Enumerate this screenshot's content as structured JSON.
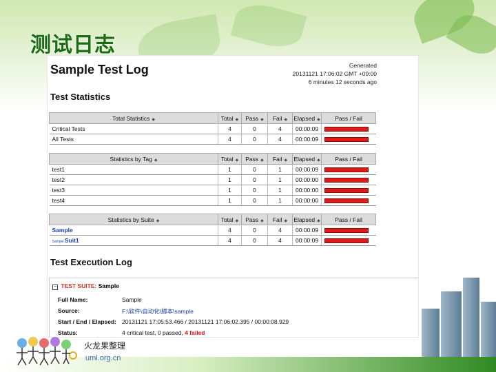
{
  "slide": {
    "title": "测试日志",
    "footer_name": "火龙果整理",
    "footer_site": "uml.org.cn",
    "colors": {
      "title": "#1b6b14",
      "fail_bar": "#dd1a1a",
      "link": "#1a3fae"
    }
  },
  "log": {
    "title": "Sample Test Log",
    "generated_label": "Generated",
    "generated_time": "20131121 17:06:02 GMT +09:00",
    "generated_ago": "6 minutes 12 seconds ago",
    "stats_heading": "Test Statistics",
    "columns": [
      "Total",
      "Pass",
      "Fail",
      "Elapsed",
      "Pass / Fail"
    ],
    "total_stats": {
      "header": "Total Statistics",
      "rows": [
        {
          "name": "Critical Tests",
          "total": "4",
          "pass": "0",
          "fail": "4",
          "elapsed": "00:00:09",
          "fail_fraction": 1
        },
        {
          "name": "All Tests",
          "total": "4",
          "pass": "0",
          "fail": "4",
          "elapsed": "00:00:09",
          "fail_fraction": 1
        }
      ]
    },
    "tag_stats": {
      "header": "Statistics by Tag",
      "rows": [
        {
          "name": "test1",
          "total": "1",
          "pass": "0",
          "fail": "1",
          "elapsed": "00:00:09",
          "fail_fraction": 1
        },
        {
          "name": "test2",
          "total": "1",
          "pass": "0",
          "fail": "1",
          "elapsed": "00:00:00",
          "fail_fraction": 1
        },
        {
          "name": "test3",
          "total": "1",
          "pass": "0",
          "fail": "1",
          "elapsed": "00:00:00",
          "fail_fraction": 1
        },
        {
          "name": "test4",
          "total": "1",
          "pass": "0",
          "fail": "1",
          "elapsed": "00:00:00",
          "fail_fraction": 1
        }
      ]
    },
    "suite_stats": {
      "header": "Statistics by Suite",
      "rows": [
        {
          "name": "Sample",
          "total": "4",
          "pass": "0",
          "fail": "4",
          "elapsed": "00:00:09",
          "fail_fraction": 1
        },
        {
          "prefix": "Sample.",
          "name": "Suit1",
          "total": "4",
          "pass": "0",
          "fail": "4",
          "elapsed": "00:00:09",
          "fail_fraction": 1
        }
      ]
    },
    "exec_heading": "Test Execution Log",
    "exec": {
      "toggle": "−",
      "suite_label": "TEST SUITE:",
      "suite_name": "Sample",
      "full_name_label": "Full Name:",
      "full_name": "Sample",
      "source_label": "Source:",
      "source": "F:\\软件\\自动化\\脚本\\sample",
      "timing_label": "Start / End / Elapsed:",
      "timing": "20131121 17:05:53.466 / 20131121 17:06:02.395 / 00:00:08.929",
      "status_label": "Status:",
      "status_text": "4 critical test, 0 passed,",
      "status_failed": "4 failed"
    }
  }
}
